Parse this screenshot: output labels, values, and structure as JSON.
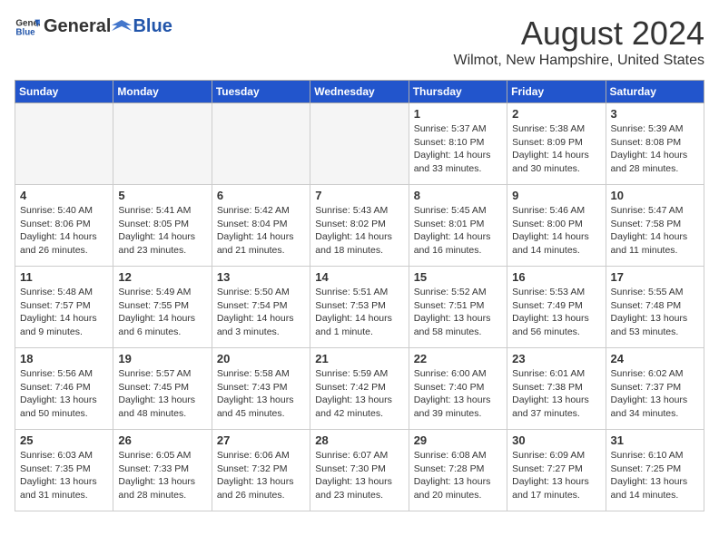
{
  "header": {
    "logo_general": "General",
    "logo_blue": "Blue",
    "month": "August 2024",
    "location": "Wilmot, New Hampshire, United States"
  },
  "days_of_week": [
    "Sunday",
    "Monday",
    "Tuesday",
    "Wednesday",
    "Thursday",
    "Friday",
    "Saturday"
  ],
  "weeks": [
    [
      {
        "day": "",
        "empty": true
      },
      {
        "day": "",
        "empty": true
      },
      {
        "day": "",
        "empty": true
      },
      {
        "day": "",
        "empty": true
      },
      {
        "day": "1",
        "sunrise": "5:37 AM",
        "sunset": "8:10 PM",
        "daylight": "14 hours and 33 minutes."
      },
      {
        "day": "2",
        "sunrise": "5:38 AM",
        "sunset": "8:09 PM",
        "daylight": "14 hours and 30 minutes."
      },
      {
        "day": "3",
        "sunrise": "5:39 AM",
        "sunset": "8:08 PM",
        "daylight": "14 hours and 28 minutes."
      }
    ],
    [
      {
        "day": "4",
        "sunrise": "5:40 AM",
        "sunset": "8:06 PM",
        "daylight": "14 hours and 26 minutes."
      },
      {
        "day": "5",
        "sunrise": "5:41 AM",
        "sunset": "8:05 PM",
        "daylight": "14 hours and 23 minutes."
      },
      {
        "day": "6",
        "sunrise": "5:42 AM",
        "sunset": "8:04 PM",
        "daylight": "14 hours and 21 minutes."
      },
      {
        "day": "7",
        "sunrise": "5:43 AM",
        "sunset": "8:02 PM",
        "daylight": "14 hours and 18 minutes."
      },
      {
        "day": "8",
        "sunrise": "5:45 AM",
        "sunset": "8:01 PM",
        "daylight": "14 hours and 16 minutes."
      },
      {
        "day": "9",
        "sunrise": "5:46 AM",
        "sunset": "8:00 PM",
        "daylight": "14 hours and 14 minutes."
      },
      {
        "day": "10",
        "sunrise": "5:47 AM",
        "sunset": "7:58 PM",
        "daylight": "14 hours and 11 minutes."
      }
    ],
    [
      {
        "day": "11",
        "sunrise": "5:48 AM",
        "sunset": "7:57 PM",
        "daylight": "14 hours and 9 minutes."
      },
      {
        "day": "12",
        "sunrise": "5:49 AM",
        "sunset": "7:55 PM",
        "daylight": "14 hours and 6 minutes."
      },
      {
        "day": "13",
        "sunrise": "5:50 AM",
        "sunset": "7:54 PM",
        "daylight": "14 hours and 3 minutes."
      },
      {
        "day": "14",
        "sunrise": "5:51 AM",
        "sunset": "7:53 PM",
        "daylight": "14 hours and 1 minute."
      },
      {
        "day": "15",
        "sunrise": "5:52 AM",
        "sunset": "7:51 PM",
        "daylight": "13 hours and 58 minutes."
      },
      {
        "day": "16",
        "sunrise": "5:53 AM",
        "sunset": "7:49 PM",
        "daylight": "13 hours and 56 minutes."
      },
      {
        "day": "17",
        "sunrise": "5:55 AM",
        "sunset": "7:48 PM",
        "daylight": "13 hours and 53 minutes."
      }
    ],
    [
      {
        "day": "18",
        "sunrise": "5:56 AM",
        "sunset": "7:46 PM",
        "daylight": "13 hours and 50 minutes."
      },
      {
        "day": "19",
        "sunrise": "5:57 AM",
        "sunset": "7:45 PM",
        "daylight": "13 hours and 48 minutes."
      },
      {
        "day": "20",
        "sunrise": "5:58 AM",
        "sunset": "7:43 PM",
        "daylight": "13 hours and 45 minutes."
      },
      {
        "day": "21",
        "sunrise": "5:59 AM",
        "sunset": "7:42 PM",
        "daylight": "13 hours and 42 minutes."
      },
      {
        "day": "22",
        "sunrise": "6:00 AM",
        "sunset": "7:40 PM",
        "daylight": "13 hours and 39 minutes."
      },
      {
        "day": "23",
        "sunrise": "6:01 AM",
        "sunset": "7:38 PM",
        "daylight": "13 hours and 37 minutes."
      },
      {
        "day": "24",
        "sunrise": "6:02 AM",
        "sunset": "7:37 PM",
        "daylight": "13 hours and 34 minutes."
      }
    ],
    [
      {
        "day": "25",
        "sunrise": "6:03 AM",
        "sunset": "7:35 PM",
        "daylight": "13 hours and 31 minutes."
      },
      {
        "day": "26",
        "sunrise": "6:05 AM",
        "sunset": "7:33 PM",
        "daylight": "13 hours and 28 minutes."
      },
      {
        "day": "27",
        "sunrise": "6:06 AM",
        "sunset": "7:32 PM",
        "daylight": "13 hours and 26 minutes."
      },
      {
        "day": "28",
        "sunrise": "6:07 AM",
        "sunset": "7:30 PM",
        "daylight": "13 hours and 23 minutes."
      },
      {
        "day": "29",
        "sunrise": "6:08 AM",
        "sunset": "7:28 PM",
        "daylight": "13 hours and 20 minutes."
      },
      {
        "day": "30",
        "sunrise": "6:09 AM",
        "sunset": "7:27 PM",
        "daylight": "13 hours and 17 minutes."
      },
      {
        "day": "31",
        "sunrise": "6:10 AM",
        "sunset": "7:25 PM",
        "daylight": "13 hours and 14 minutes."
      }
    ]
  ]
}
